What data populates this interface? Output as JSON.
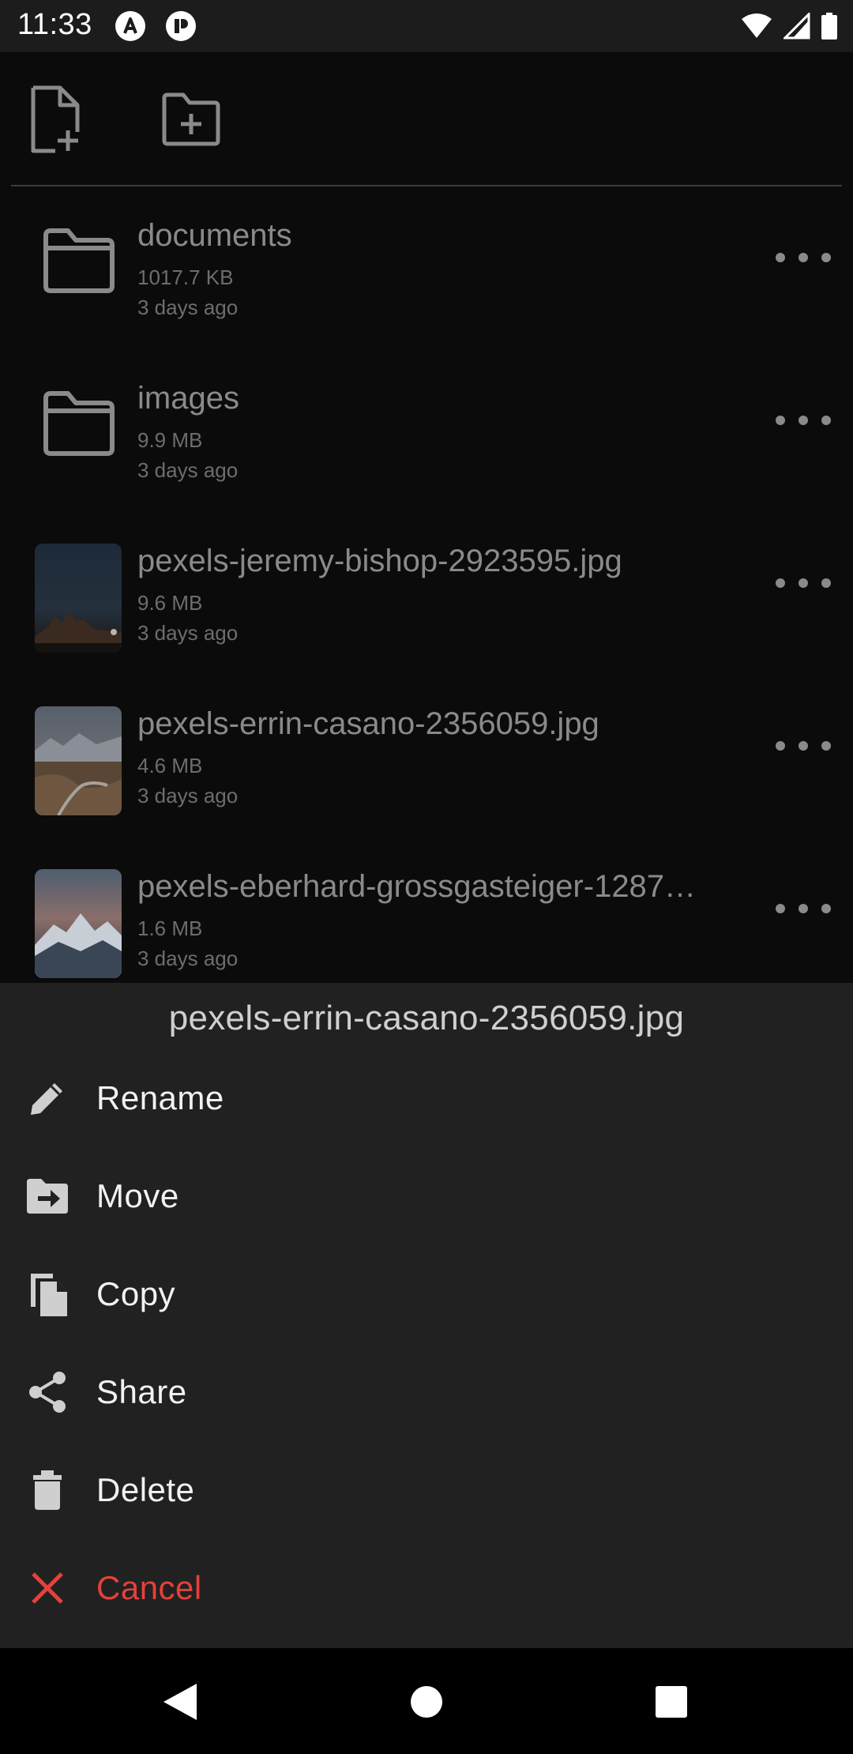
{
  "status_bar": {
    "time": "11:33"
  },
  "toolbar": {
    "new_file_icon": "file-plus-icon",
    "new_folder_icon": "folder-plus-icon"
  },
  "files": [
    {
      "kind": "folder",
      "name": "documents",
      "size": "1017.7 KB",
      "date": "3 days ago"
    },
    {
      "kind": "folder",
      "name": "images",
      "size": "9.9 MB",
      "date": "3 days ago"
    },
    {
      "kind": "image",
      "name": "pexels-jeremy-bishop-2923595.jpg",
      "size": "9.6 MB",
      "date": "3 days ago"
    },
    {
      "kind": "image",
      "name": "pexels-errin-casano-2356059.jpg",
      "size": "4.6 MB",
      "date": "3 days ago"
    },
    {
      "kind": "image",
      "name": "pexels-eberhard-grossgasteiger-1287…",
      "size": "1.6 MB",
      "date": "3 days ago"
    }
  ],
  "sheet": {
    "title": "pexels-errin-casano-2356059.jpg",
    "items": [
      {
        "label": "Rename",
        "icon": "pencil-icon"
      },
      {
        "label": "Move",
        "icon": "folder-move-icon"
      },
      {
        "label": "Copy",
        "icon": "copy-icon"
      },
      {
        "label": "Share",
        "icon": "share-icon"
      },
      {
        "label": "Delete",
        "icon": "trash-icon"
      },
      {
        "label": "Cancel",
        "icon": "close-icon"
      }
    ]
  },
  "colors": {
    "cancel_red": "#e5413a",
    "sheet_bg": "#212121",
    "background": "#0b0b0b"
  }
}
